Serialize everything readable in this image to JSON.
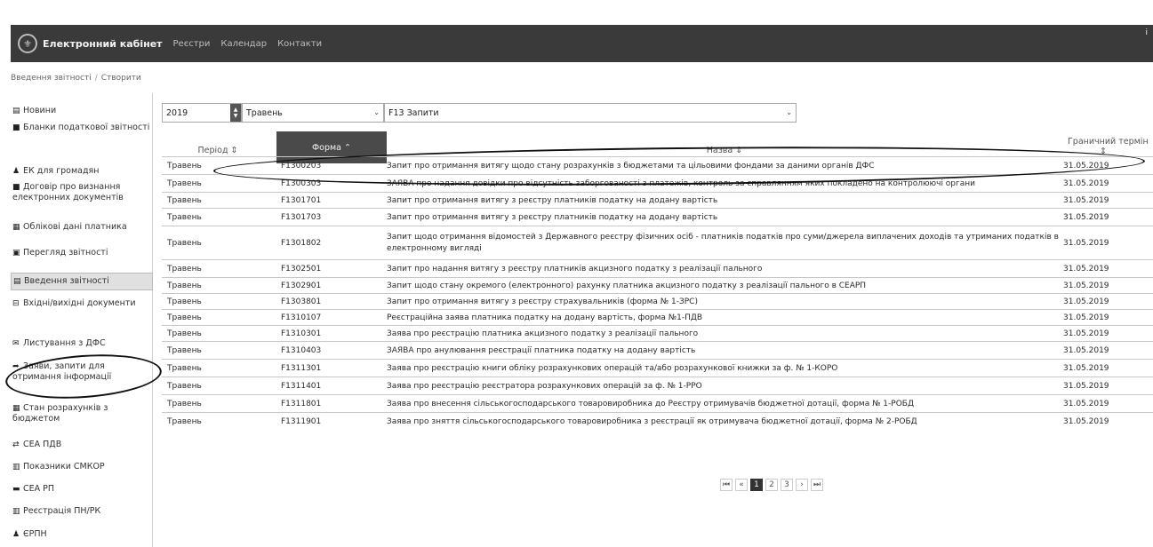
{
  "app": {
    "brand": "Електронний кабінет",
    "nav": [
      "Реєстри",
      "Календар",
      "Контакти"
    ]
  },
  "breadcrumb": [
    "Введення звітності",
    "Створити"
  ],
  "sidebar": {
    "items": [
      {
        "icon": "news-icon",
        "glyph": "▤",
        "label": "Новини"
      },
      {
        "icon": "document-icon",
        "glyph": "■",
        "label": "Бланки податкової звітності"
      },
      {
        "icon": "user-icon",
        "glyph": "♟",
        "label": "ЕК для громадян"
      },
      {
        "icon": "contract-icon",
        "glyph": "■",
        "label": "Договір про визнання електронних документів"
      },
      {
        "icon": "card-icon",
        "glyph": "▦",
        "label": "Облікові дані платника"
      },
      {
        "icon": "view-icon",
        "glyph": "▣",
        "label": "Перегляд звітності"
      },
      {
        "icon": "edit-icon",
        "glyph": "▤",
        "label": "Введення звітності"
      },
      {
        "icon": "inbox-icon",
        "glyph": "⊟",
        "label": "Вхідні/вихідні документи"
      },
      {
        "icon": "mail-icon",
        "glyph": "✉",
        "label": "Листування з ДФС"
      },
      {
        "icon": "share-icon",
        "glyph": "➦",
        "label": "Заяви, запити для отримання інформації"
      },
      {
        "icon": "calc-icon",
        "glyph": "▦",
        "label": "Стан розрахунків з бюджетом"
      },
      {
        "icon": "exchange-icon",
        "glyph": "⇄",
        "label": "СЕА ПДВ"
      },
      {
        "icon": "chart-icon",
        "glyph": "▥",
        "label": "Показники СМКОР"
      },
      {
        "icon": "table-icon",
        "glyph": "▬",
        "label": "СЕА РП"
      },
      {
        "icon": "register-icon",
        "glyph": "▥",
        "label": "Реєстрація ПН/РК"
      },
      {
        "icon": "users-icon",
        "glyph": "♟",
        "label": "ЄРПН"
      }
    ]
  },
  "filters": {
    "year": "2019",
    "month": "Травень",
    "group": "F13 Запити"
  },
  "table": {
    "headers": {
      "period": "Період ⇕",
      "form": "Форма ⌃",
      "name": "Назва ⇕",
      "deadline": "Граничний термін"
    },
    "deadline_sort": "⇕",
    "rows": [
      {
        "period": "Травень",
        "form": "F1300203",
        "name": "Запит про отримання витягу щодо стану розрахунків з бюджетами та цільовими фондами за даними органів ДФС",
        "deadline": "31.05.2019"
      },
      {
        "period": "Травень",
        "form": "F1300303",
        "name": "ЗАЯВА про надання довідки про відсутність заборгованості з платежів, контроль за справлянням яких покладено на контролюючі органи",
        "deadline": "31.05.2019"
      },
      {
        "period": "Травень",
        "form": "F1301701",
        "name": "Запит про отримання витягу з реєстру платників податку на додану вартість",
        "deadline": "31.05.2019"
      },
      {
        "period": "Травень",
        "form": "F1301703",
        "name": "Запит про отримання витягу з реєстру платників податку на додану вартість",
        "deadline": "31.05.2019"
      },
      {
        "period": "Травень",
        "form": "F1301802",
        "name": "Запит щодо отримання відомостей з Державного реєстру фізичних осіб - платників податків про суми/джерела виплачених доходів та утриманих податків в електронному вигляді",
        "deadline": "31.05.2019"
      },
      {
        "period": "Травень",
        "form": "F1302501",
        "name": "Запит про надання витягу з реєстру платників акцизного податку з реалізації пального",
        "deadline": "31.05.2019"
      },
      {
        "period": "Травень",
        "form": "F1302901",
        "name": "Запит щодо стану окремого (електронного) рахунку платника акцизного податку з реалізації пального в СЕАРП",
        "deadline": "31.05.2019"
      },
      {
        "period": "Травень",
        "form": "F1303801",
        "name": "Запит про отримання витягу з реєстру страхувальників (форма № 1-ЗРС)",
        "deadline": "31.05.2019"
      },
      {
        "period": "Травень",
        "form": "F1310107",
        "name": "Реєстраційна заява платника податку на додану вартість, форма №1-ПДВ",
        "deadline": "31.05.2019"
      },
      {
        "period": "Травень",
        "form": "F1310301",
        "name": "Заява про реєстрацію платника акцизного податку з реалізації пального",
        "deadline": "31.05.2019"
      },
      {
        "period": "Травень",
        "form": "F1310403",
        "name": "ЗАЯВА про анулювання реєстрації платника податку на додану вартість",
        "deadline": "31.05.2019"
      },
      {
        "period": "Травень",
        "form": "F1311301",
        "name": "Заява про реєстрацію книги обліку розрахункових операцій та/або розрахункової книжки за ф. № 1-КОРО",
        "deadline": "31.05.2019"
      },
      {
        "period": "Травень",
        "form": "F1311401",
        "name": "Заява про реєстрацію реєстратора розрахункових операцій за ф. № 1-РРО",
        "deadline": "31.05.2019"
      },
      {
        "period": "Травень",
        "form": "F1311801",
        "name": "Заява про внесення сільськогосподарського товаровиробника до Реєстру отримувачів бюджетної дотації, форма № 1-РОБД",
        "deadline": "31.05.2019"
      },
      {
        "period": "Травень",
        "form": "F1311901",
        "name": "Заява про зняття сільськогосподарського товаровиробника з реєстрації як отримувача бюджетної дотації, форма № 2-РОБД",
        "deadline": "31.05.2019"
      }
    ]
  },
  "pagination": {
    "first": "⏮",
    "prev": "«",
    "pages": [
      "1",
      "2",
      "3"
    ],
    "current": "1",
    "next": "›",
    "last": "⏭"
  }
}
